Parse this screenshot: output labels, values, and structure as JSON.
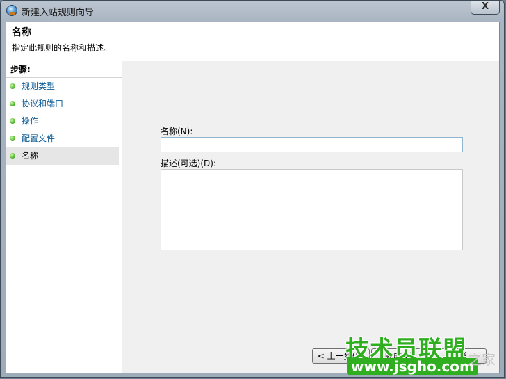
{
  "window": {
    "title": "新建入站规则向导",
    "close_glyph": "X"
  },
  "header": {
    "title": "名称",
    "description": "指定此规则的名称和描述。"
  },
  "sidebar": {
    "steps_label": "步骤:",
    "items": [
      {
        "label": "规则类型",
        "state": "link"
      },
      {
        "label": "协议和端口",
        "state": "link"
      },
      {
        "label": "操作",
        "state": "link"
      },
      {
        "label": "配置文件",
        "state": "link"
      },
      {
        "label": "名称",
        "state": "current"
      }
    ]
  },
  "form": {
    "name_label": "名称(N):",
    "name_value": "",
    "description_label": "描述(可选)(D):",
    "description_value": ""
  },
  "buttons": {
    "back": "< 上一步(B)",
    "finish": "完成(F)",
    "cancel": "取消"
  },
  "watermark": {
    "main": "技术员联盟",
    "url": "www.jsgho.com",
    "sub": "之家"
  }
}
